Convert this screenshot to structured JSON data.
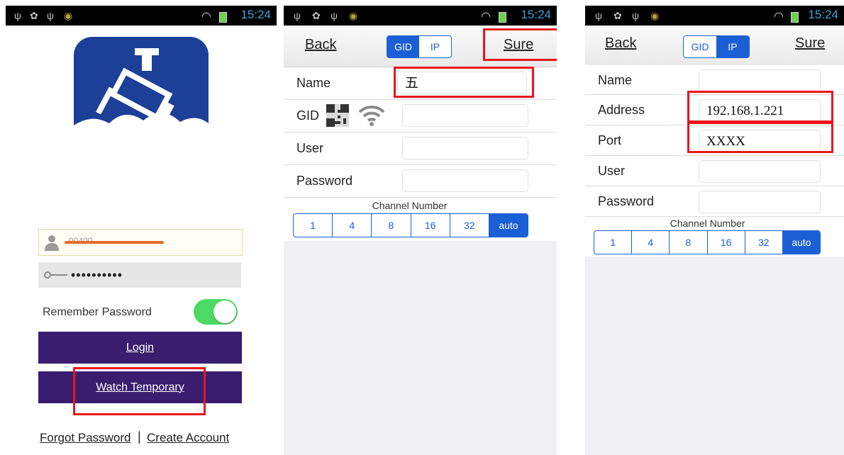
{
  "status_bar": {
    "time": "15:24"
  },
  "login_screen": {
    "username_value": "00400.........",
    "password_mask": "••••••••••",
    "remember_label": "Remember Password",
    "remember_enabled": true,
    "login_label": "Login",
    "watch_label": "Watch Temporary",
    "forgot_label": "Forgot Password",
    "separator": "|",
    "create_label": "Create Account"
  },
  "gid_screen": {
    "back_label": "Back",
    "seg_gid": "GID",
    "seg_ip": "IP",
    "sure_label": "Sure",
    "name_label": "Name",
    "name_value": "五",
    "gid_label": "GID",
    "user_label": "User",
    "password_label": "Password",
    "channel_caption": "Channel Number",
    "channels": [
      "1",
      "4",
      "8",
      "16",
      "32",
      "auto"
    ]
  },
  "ip_screen": {
    "back_label": "Back",
    "seg_gid": "GID",
    "seg_ip": "IP",
    "sure_label": "Sure",
    "name_label": "Name",
    "address_label": "Address",
    "address_value": "192.168.1.221",
    "port_label": "Port",
    "port_value": "XXXX",
    "user_label": "User",
    "password_label": "Password",
    "channel_caption": "Channel Number",
    "channels": [
      "1",
      "4",
      "8",
      "16",
      "32",
      "auto"
    ]
  },
  "colors": {
    "accent_blue": "#1b5fd6",
    "button_purple": "#3a1d6e",
    "highlight_red": "#e8161b",
    "toggle_green": "#4cd964",
    "status_time": "#3aa2d8"
  }
}
